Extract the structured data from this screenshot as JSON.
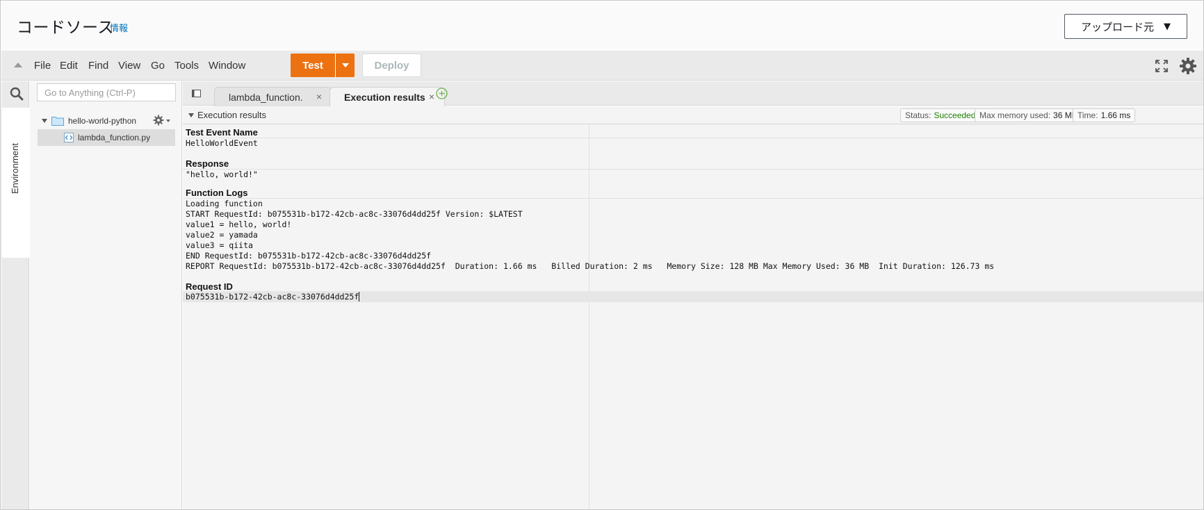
{
  "header": {
    "title": "コードソース",
    "info_link": "情報",
    "upload_button": "アップロード元",
    "upload_caret": "▼"
  },
  "menubar": {
    "items": [
      "File",
      "Edit",
      "Find",
      "View",
      "Go",
      "Tools",
      "Window"
    ],
    "test_label": "Test",
    "deploy_label": "Deploy"
  },
  "sidebar": {
    "environment_label": "Environment",
    "search_placeholder": "Go to Anything (Ctrl-P)",
    "folder_name": "hello-world-python",
    "file_name": "lambda_function.py"
  },
  "tabs": [
    {
      "label": "lambda_function.",
      "close": "×"
    },
    {
      "label": "Execution results",
      "close": "×"
    }
  ],
  "results": {
    "panel_title": "Execution results",
    "status_label": "Status:",
    "status_value": "Succeeded",
    "memory_label": "Max memory used:",
    "memory_value": "36 MB",
    "time_label": "Time:",
    "time_value": "1.66 ms",
    "test_event_heading": "Test Event Name",
    "test_event_value": "HelloWorldEvent",
    "response_heading": "Response",
    "response_value": "\"hello, world!\"",
    "logs_heading": "Function Logs",
    "logs": [
      "Loading function",
      "START RequestId: b075531b-b172-42cb-ac8c-33076d4dd25f Version: $LATEST",
      "value1 = hello, world!",
      "value2 = yamada",
      "value3 = qiita",
      "END RequestId: b075531b-b172-42cb-ac8c-33076d4dd25f",
      "REPORT RequestId: b075531b-b172-42cb-ac8c-33076d4dd25f  Duration: 1.66 ms   Billed Duration: 2 ms   Memory Size: 128 MB Max Memory Used: 36 MB  Init Duration: 126.73 ms"
    ],
    "request_id_heading": "Request ID",
    "request_id_value": "b075531b-b172-42cb-ac8c-33076d4dd25f"
  }
}
